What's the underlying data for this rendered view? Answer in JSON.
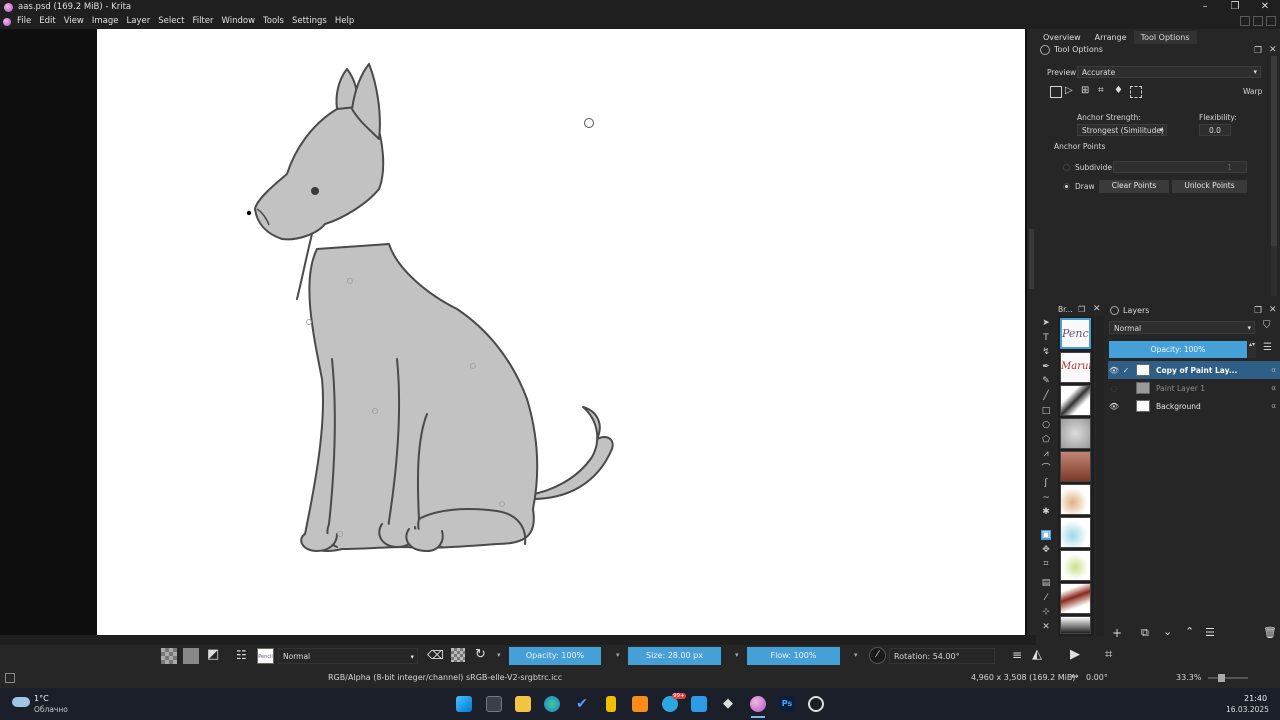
{
  "window": {
    "title": "aas.psd (169.2 MiB)  - Krita",
    "controls": [
      "–",
      "❐",
      "✕"
    ]
  },
  "menu": [
    "File",
    "Edit",
    "View",
    "Image",
    "Layer",
    "Select",
    "Filter",
    "Window",
    "Tools",
    "Settings",
    "Help"
  ],
  "right_tabs": [
    "Overview",
    "Arrange",
    "Tool Options"
  ],
  "tool_options": {
    "header": "Tool Options",
    "preview_label": "Preview",
    "preview_value": "Accurate",
    "mode_label": "Warp",
    "anchor_strength_label": "Anchor Strength:",
    "anchor_strength_value": "Strongest (Similitude)",
    "flexibility_label": "Flexibility:",
    "flexibility_value": "0.0",
    "anchor_points_label": "Anchor Points",
    "subdivide_label": "Subdivide",
    "subdivide_value": "1",
    "draw_label": "Draw",
    "clear_points": "Clear Points",
    "unlock_points": "Unlock Points"
  },
  "brush_panel_title": "Br...",
  "brush_labels": [
    "Pencil",
    "Marui"
  ],
  "layers": {
    "header": "Layers",
    "blend_mode": "Normal",
    "opacity": "Opacity:  100%",
    "opacity_value": 100,
    "items": [
      {
        "name": "Copy of Paint Lay...",
        "visible": true,
        "selected": true
      },
      {
        "name": "Paint Layer 1",
        "visible": false,
        "selected": false
      },
      {
        "name": "Background",
        "visible": true,
        "selected": false
      }
    ],
    "flags": "α"
  },
  "bottom_toolbar": {
    "blend_mode": "Normal",
    "opacity": "Opacity: 100%",
    "size": "Size: 28.00 px",
    "flow": "Flow: 100%",
    "rotation": "Rotation: 54.00°"
  },
  "status": {
    "color_space": "RGB/Alpha (8-bit integer/channel)  sRGB-elle-V2-srgbtrc.icc",
    "dimensions": "4,960 x 3,508 (169.2 MiB)",
    "angle": "0.00°",
    "zoom": "33.3%"
  },
  "taskbar": {
    "weather_temp": "1°C",
    "weather_text": "Облачно",
    "time": "21:40",
    "date": "16.03.2025",
    "badge": "99+"
  },
  "colors": {
    "accent": "#46a0d8",
    "selected_layer": "#2f5f86",
    "panel": "#262626",
    "canvas_bg": "#0e0e0e"
  }
}
